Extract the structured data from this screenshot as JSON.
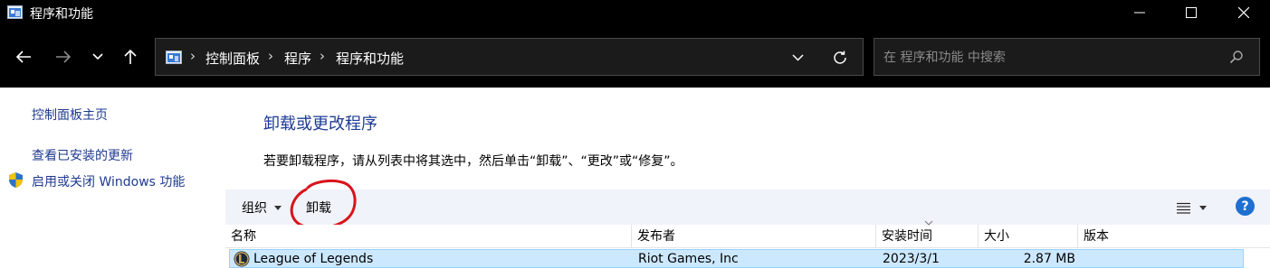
{
  "window": {
    "title": "程序和功能"
  },
  "address": {
    "crumbs": [
      "控制面板",
      "程序",
      "程序和功能"
    ],
    "separator": "›"
  },
  "search": {
    "placeholder": "在 程序和功能 中搜索"
  },
  "sidebar": {
    "items": [
      {
        "label": "控制面板主页"
      },
      {
        "label": "查看已安装的更新"
      },
      {
        "label": "启用或关闭 Windows 功能"
      }
    ]
  },
  "main": {
    "heading": "卸载或更改程序",
    "description": "若要卸载程序，请从列表中将其选中，然后单击“卸载”、“更改”或“修复”。"
  },
  "toolbar": {
    "organize_label": "组织",
    "uninstall_label": "卸载",
    "help_label": "?"
  },
  "table": {
    "columns": [
      "名称",
      "发布者",
      "安装时间",
      "大小",
      "版本"
    ],
    "rows": [
      {
        "name": "League of Legends",
        "publisher": "Riot Games, Inc",
        "installed": "2023/3/1",
        "size": "2.87 MB",
        "version": ""
      }
    ]
  },
  "colors": {
    "titlebar_bg": "#000000",
    "link": "#1f3a8f",
    "heading": "#1e3c96",
    "toolbar_bg": "#f0f3f9",
    "selected_row": "#cce8ff",
    "annotation_red": "#d8141b"
  }
}
